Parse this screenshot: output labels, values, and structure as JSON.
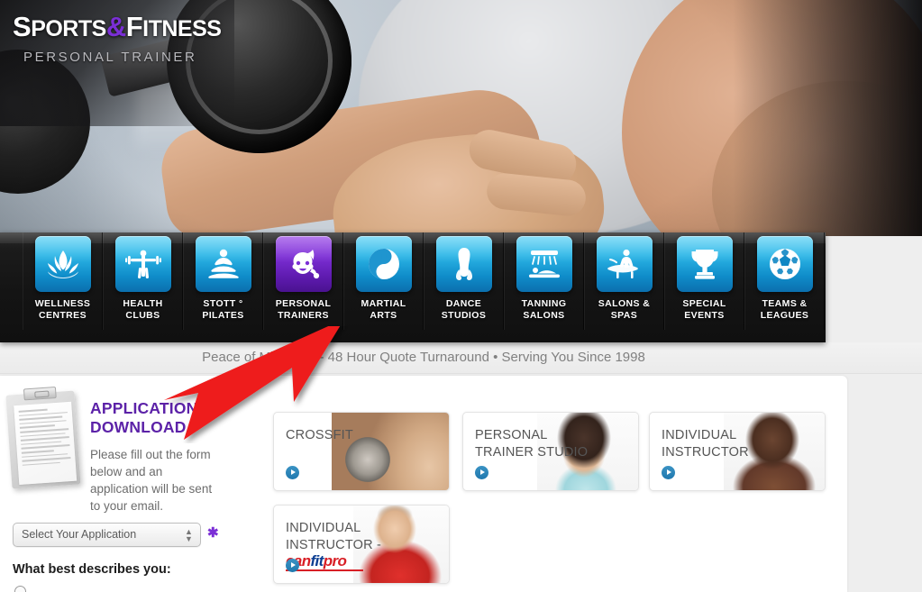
{
  "brand": {
    "name_part1": "S",
    "name_part1_rest": "PORTS",
    "amp": "&",
    "name_part2": "F",
    "name_part2_rest": "ITNESS",
    "subtitle": "PERSONAL TRAINER",
    "accent_purple": "#7B2FD6",
    "heading_purple": "#5C22A8",
    "nav_blue": "#1f8ec9"
  },
  "nav": {
    "items": [
      {
        "label_line1": "WELLNESS",
        "label_line2": "CENTRES",
        "icon": "lotus-icon",
        "active": false
      },
      {
        "label_line1": "HEALTH",
        "label_line2": "CLUBS",
        "icon": "barbell-icon",
        "active": false
      },
      {
        "label_line1": "STOTT °",
        "label_line2": "PILATES",
        "icon": "pilates-icon",
        "active": false
      },
      {
        "label_line1": "PERSONAL",
        "label_line2": "TRAINERS",
        "icon": "trainer-icon",
        "active": true
      },
      {
        "label_line1": "MARTIAL",
        "label_line2": "ARTS",
        "icon": "yin-yang-icon",
        "active": false
      },
      {
        "label_line1": "DANCE",
        "label_line2": "STUDIOS",
        "icon": "ballet-shoe-icon",
        "active": false
      },
      {
        "label_line1": "TANNING",
        "label_line2": "SALONS",
        "icon": "tanning-bed-icon",
        "active": false
      },
      {
        "label_line1": "SALONS &",
        "label_line2": "SPAS",
        "icon": "massage-icon",
        "active": false
      },
      {
        "label_line1": "SPECIAL",
        "label_line2": "EVENTS",
        "icon": "trophy-icon",
        "active": false
      },
      {
        "label_line1": "TEAMS &",
        "label_line2": "LEAGUES",
        "icon": "soccer-ball-icon",
        "active": false
      }
    ]
  },
  "tagline": "Peace of Mind • 24 - 48 Hour Quote Turnaround • Serving You Since 1998",
  "application": {
    "heading_line1": "APPLICATION",
    "heading_line2": "DOWNLOAD",
    "description": "Please fill out the form below and an application will be sent to your email.",
    "select_value": "Select Your Application",
    "required_marker": "✱",
    "describes_label": "What best describes you:"
  },
  "cards": [
    {
      "title_line1": "CROSSFIT",
      "title_line2": "",
      "photo": "man-lifting-dumbbell",
      "play": "play-icon"
    },
    {
      "title_line1": "PERSONAL",
      "title_line2": "TRAINER STUDIO",
      "photo": "woman-with-towel",
      "play": "play-icon"
    },
    {
      "title_line1": "INDIVIDUAL",
      "title_line2": "INSTRUCTOR",
      "photo": "smiling-man",
      "play": "play-icon"
    },
    {
      "title_line1": "INDIVIDUAL",
      "title_line2": "INSTRUCTOR -",
      "photo": "man-in-red-shirt",
      "play": "play-icon",
      "logo": {
        "part1": "can",
        "part2": "fit",
        "part3": "pro"
      }
    }
  ],
  "annotation": {
    "type": "red-arrow",
    "points_to": "application-download-heading",
    "color": "#ee1c1c"
  }
}
